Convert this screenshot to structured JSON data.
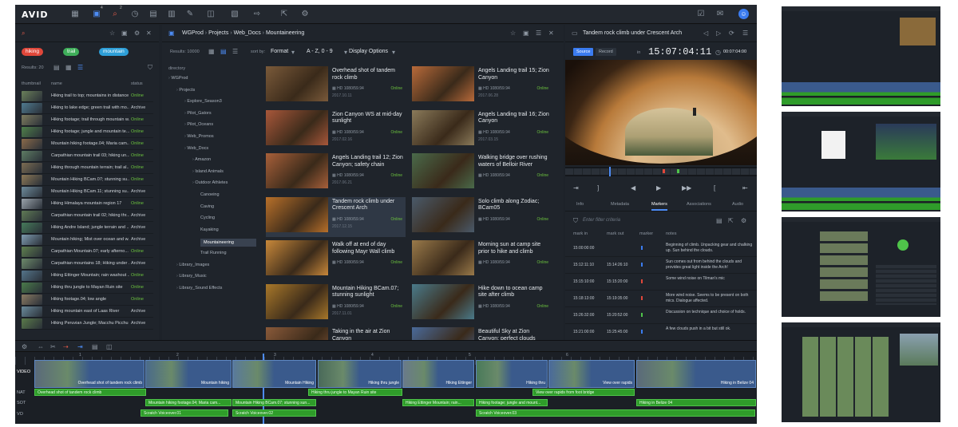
{
  "topbar": {
    "logo": "AVID",
    "badge_a": "4",
    "badge_b": "2",
    "user_initial": "☺"
  },
  "left": {
    "chips": [
      {
        "label": "hiking",
        "color": "#e0473a"
      },
      {
        "label": "trail",
        "color": "#3fae5a"
      },
      {
        "label": "mountain",
        "color": "#2e9fd8"
      }
    ],
    "results": "Results: 20",
    "col_thumb": "thumbnail",
    "col_name": "name",
    "col_status": "status",
    "rows": [
      {
        "name": "Hiking trail to top; mountains in distance",
        "status": "Online",
        "c": "#6a7f5a"
      },
      {
        "name": "Hiking to lake edge; green trail with mo...",
        "status": "Archive",
        "c": "#4f7a8f"
      },
      {
        "name": "Hiking footage; trail through mountain w...",
        "status": "Online",
        "c": "#7d7b5e"
      },
      {
        "name": "Hiking footage; jungle and mountain te...",
        "status": "Online",
        "c": "#4f7f4a"
      },
      {
        "name": "Mountain hiking footage.04; Maria cam...",
        "status": "Online",
        "c": "#8a6a4a"
      },
      {
        "name": "Carpathian mountain trail 03; hiking un...",
        "status": "Online",
        "c": "#5e7c63"
      },
      {
        "name": "Hiking through mountain terrain; trail al...",
        "status": "Online",
        "c": "#7c6c52"
      },
      {
        "name": "Mountain Hiking BCam.07; stunning su...",
        "status": "Online",
        "c": "#8c7856"
      },
      {
        "name": "Mountain Hiking BCam.11; stunning su...",
        "status": "Archive",
        "c": "#6d8a9a"
      },
      {
        "name": "Hiking Himalaya mountain region 17",
        "status": "Online",
        "c": "#9aa3ab"
      },
      {
        "name": "Carpathian mountain trail 02; hiking thr...",
        "status": "Archive",
        "c": "#5f7a55"
      },
      {
        "name": "Hiking Andre Island; jungle terrain and ...",
        "status": "Archive",
        "c": "#467a5a"
      },
      {
        "name": "Mountain hiking; Mist over ocean and w...",
        "status": "Archive",
        "c": "#7f9bb0"
      },
      {
        "name": "Carpathian Mountain.07; early afterno...",
        "status": "Online",
        "c": "#5f7f4f"
      },
      {
        "name": "Carpathian mountains 18; Hiking under ...",
        "status": "Archive",
        "c": "#6d8a6a"
      },
      {
        "name": "Hiking Ettinger Mountain; rain washout ...",
        "status": "Online",
        "c": "#54748a"
      },
      {
        "name": "Hiking thru jungle to Mayan Ruin site",
        "status": "Online",
        "c": "#4a7a4a"
      },
      {
        "name": "Hiking footage.04; low angle",
        "status": "Online",
        "c": "#8a7a62"
      },
      {
        "name": "Hiking mountain east of Laas River",
        "status": "Archive",
        "c": "#6a8a9a"
      },
      {
        "name": "Hiking Peruvian Jungle; Macchu Picchu",
        "status": "Archive",
        "c": "#5a7a4a"
      }
    ]
  },
  "mid": {
    "breadcrumb": [
      "WGProd",
      "Projects",
      "Web_Docs",
      "Mountaineering"
    ],
    "results": "Results: 10000",
    "sort_by": "sort by:",
    "sort_field": "Format",
    "sort_order": "A - Z, 0 - 9",
    "display_options": "Display Options",
    "dir_label": "directory",
    "tree": [
      {
        "label": "WGProd",
        "indent": 0,
        "sel": false
      },
      {
        "label": "Projects",
        "indent": 1,
        "sel": false
      },
      {
        "label": "Explore_Season3",
        "indent": 2,
        "sel": false
      },
      {
        "label": "Pilot_Gators",
        "indent": 2,
        "sel": false
      },
      {
        "label": "Pilot_Oceans",
        "indent": 2,
        "sel": false
      },
      {
        "label": "Web_Promos",
        "indent": 2,
        "sel": false
      },
      {
        "label": "Web_Docs",
        "indent": 2,
        "sel": false
      },
      {
        "label": "Amazon",
        "indent": 3,
        "sel": false
      },
      {
        "label": "Island Animals",
        "indent": 3,
        "sel": false
      },
      {
        "label": "Outdoor Athletes",
        "indent": 3,
        "sel": false
      },
      {
        "label": "Canoeing",
        "indent": 4,
        "sel": false
      },
      {
        "label": "Caving",
        "indent": 4,
        "sel": false
      },
      {
        "label": "Cycling",
        "indent": 4,
        "sel": false
      },
      {
        "label": "Kayaking",
        "indent": 4,
        "sel": false
      },
      {
        "label": "Mountaineering",
        "indent": 4,
        "sel": true
      },
      {
        "label": "Trail Running",
        "indent": 4,
        "sel": false
      },
      {
        "label": "Library_Images",
        "indent": 1,
        "sel": false
      },
      {
        "label": "Library_Music",
        "indent": 1,
        "sel": false
      },
      {
        "label": "Library_Sound Effects",
        "indent": 1,
        "sel": false
      }
    ],
    "cards": [
      {
        "title": "Overhead shot of tandem rock climb",
        "fmt": "HD 1080/59.94",
        "status": "Online",
        "date": "2017.10.11",
        "c": "#7a5a3a"
      },
      {
        "title": "Angels Landing trail 15; Zion Canyon",
        "fmt": "HD 1080/59.94",
        "status": "Online",
        "date": "2017.06.28",
        "c": "#b86a3a"
      },
      {
        "title": "Zion Canyon WS at mid-day sunlight",
        "fmt": "HD 1080/59.94",
        "status": "Online",
        "date": "2017.02.16",
        "c": "#a8573a"
      },
      {
        "title": "Angels Landing trail 16; Zion Canyon",
        "fmt": "HD 1080/59.94",
        "status": "Online",
        "date": "2017.03.15",
        "c": "#8a7a5a"
      },
      {
        "title": "Angels Landing trail 12; Zion Canyon; safety chain",
        "fmt": "HD 1080/59.94",
        "status": "Online",
        "date": "2017.06.21",
        "c": "#a8603a"
      },
      {
        "title": "Walking bridge over rushing waters of Belloir River",
        "fmt": "HD 1080/59.94",
        "status": "Online",
        "date": "",
        "c": "#4a6a4a"
      },
      {
        "title": "Tandem rock climb under Crescent Arch",
        "fmt": "HD 1080/59.94",
        "status": "Online",
        "date": "2017.12.15",
        "c": "#b8702a"
      },
      {
        "title": "Solo climb along Zodiac; BCam05",
        "fmt": "HD 1080/59.94",
        "status": "Online",
        "date": "",
        "c": "#4a5a6a"
      },
      {
        "title": "Walk off at end of day following Mayr Wall climb",
        "fmt": "HD 1080/59.94",
        "status": "Online",
        "date": "",
        "c": "#c8883a"
      },
      {
        "title": "Morning sun at camp site prior to hike and climb",
        "fmt": "HD 1080/59.94",
        "status": "Online",
        "date": "",
        "c": "#9a7a4a"
      },
      {
        "title": "Mountain Hiking BCam.07; stunning sunlight",
        "fmt": "HD 1080/59.94",
        "status": "Online",
        "date": "2017.11.01",
        "c": "#a8782a"
      },
      {
        "title": "Hike down to ocean camp site after climb",
        "fmt": "HD 1080/59.94",
        "status": "Online",
        "date": "",
        "c": "#4a7a8a"
      },
      {
        "title": "Taking in the air at Zion Canyon",
        "fmt": "",
        "status": "",
        "date": "",
        "c": "#8a5a3a"
      },
      {
        "title": "Beautiful Sky at Zion Canyon; perfect clouds",
        "fmt": "",
        "status": "",
        "date": "",
        "c": "#4a6a9a"
      }
    ]
  },
  "right": {
    "title": "Tandem rock climb under Crescent Arch",
    "source": "Source",
    "record": "Record",
    "tc_prefix": "in",
    "timecode": "15:07:04:11",
    "duration": "00:07:04:00",
    "tabs": [
      "Info",
      "Metadata",
      "Markers",
      "Associations",
      "Audio"
    ],
    "filter_placeholder": "Enter filter criteria",
    "col_in": "mark in",
    "col_out": "mark out",
    "col_marker": "marker",
    "col_notes": "notes",
    "markers": [
      {
        "in": "15:00:00:00",
        "out": "",
        "color": "#3b7cf0",
        "notes": "Beginning of climb. Unpacking gear and chalking up. Sun behind the clouds."
      },
      {
        "in": "15:12:11:10",
        "out": "15:14:26:10",
        "color": "#3b7cf0",
        "notes": "Sun comes out from behind the clouds and provides great light inside the Arch!"
      },
      {
        "in": "15:15:10:00",
        "out": "15:15:20:00",
        "color": "#e0473a",
        "notes": "Some wind noise on Tilman's mic"
      },
      {
        "in": "15:18:13:00",
        "out": "15:19:35:00",
        "color": "#e0473a",
        "notes": "More wind noise. Seems to be present on both mics. Dialogue affected."
      },
      {
        "in": "15:26:32:00",
        "out": "15:20:52:00",
        "color": "#4fc44a",
        "notes": "Discussion on technique and choice of holds."
      },
      {
        "in": "15:21:00:00",
        "out": "15:25:45:00",
        "color": "#3b7cf0",
        "notes": "A few clouds push in a bit but still ok."
      }
    ]
  },
  "timeline": {
    "tracks": [
      "VIDEO",
      "NAT",
      "SOT",
      "VO"
    ],
    "ruler": [
      "1",
      "2",
      "3",
      "4",
      "5",
      "6"
    ],
    "video_clips": [
      {
        "label": "Overhead shot of tandem rock climb",
        "c": "#5a6a7a"
      },
      {
        "label": "Mountain hiking",
        "c": "#4a6a8a"
      },
      {
        "label": "Mountain Hiking",
        "c": "#5a7a9a"
      },
      {
        "label": "Hiking thru jungle",
        "c": "#4a6a5a"
      },
      {
        "label": "Hiking Ettinger",
        "c": "#6a7a8a"
      },
      {
        "label": "Hiking thru",
        "c": "#4a7a5a"
      },
      {
        "label": "View over rapids",
        "c": "#4a6a9a"
      },
      {
        "label": "Hiking in Belize 04",
        "c": "#5a6a7a"
      }
    ],
    "nat": [
      "Overhead shot of tandem rock climb",
      "Hiking thru jungle to Mayan Ruin site",
      "View over rapids from foot bridge"
    ],
    "sot": [
      "Mountain hiking footage.04; Maria cam...",
      "Mountain Hiking BCam.07; stunning sun...",
      "Hiking Ettinger Mountain; rain...",
      "Hiking footage; jungle and mount...",
      "Hiking in Belize 04",
      "Hiking in Belize 04"
    ],
    "vo": [
      "Scratch Voiceover.01",
      "Scratch Voiceover.02",
      "Scratch Voiceover.03"
    ]
  }
}
